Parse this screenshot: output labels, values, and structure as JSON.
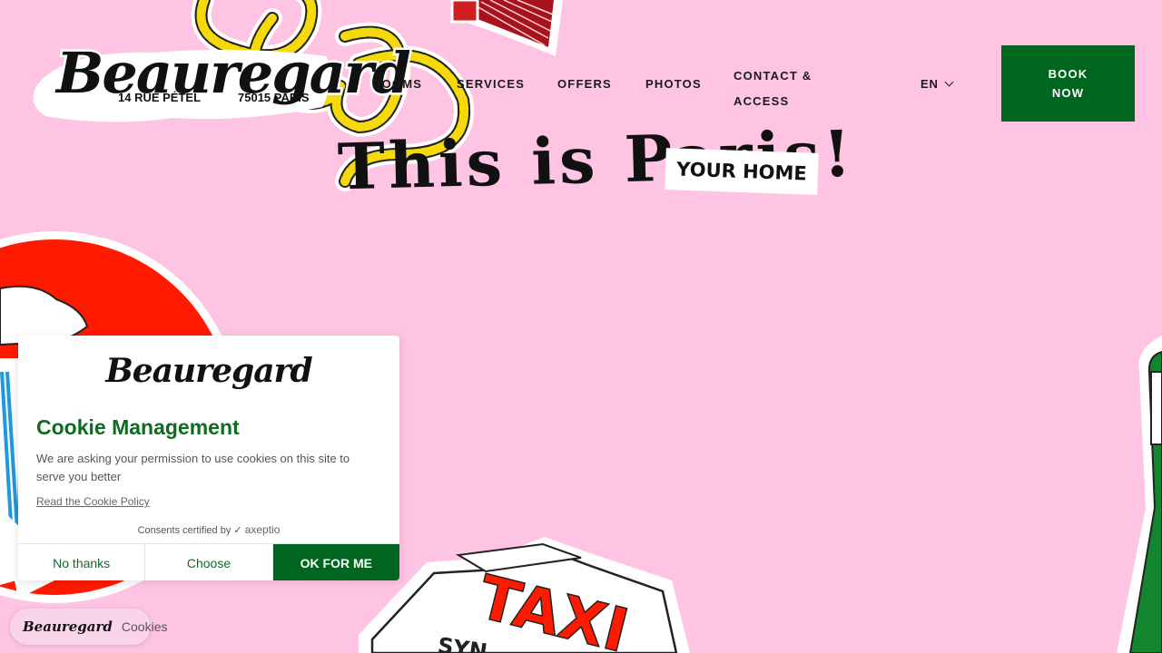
{
  "brand": {
    "logo": "Beauregard",
    "address_street": "14 RUE PÉTEL",
    "address_city": "75015 PARIS"
  },
  "nav": {
    "items": [
      "ROOMS",
      "SERVICES",
      "OFFERS",
      "PHOTOS",
      "CONTACT & ACCESS"
    ],
    "lang": "EN",
    "book_label": "BOOK NOW"
  },
  "hero": {
    "title": "This is Paris!",
    "sticker": "YOUR HOME"
  },
  "decor": {
    "taxi_sign": "TAXI",
    "taxi_sub": "SYN"
  },
  "cookie": {
    "logo": "Beauregard",
    "title": "Cookie Management",
    "text": "We are asking your permission to use cookies on this site to serve you better",
    "policy_link": "Read the Cookie Policy",
    "certified": "Consents certified by",
    "certifier": "axeptio",
    "btn_no": "No thanks",
    "btn_choose": "Choose",
    "btn_ok": "OK FOR ME"
  },
  "cookie_pill": {
    "logo": "Beauregard",
    "label": "Cookies"
  },
  "colors": {
    "background": "#ffc4e3",
    "brand_green": "#00661f",
    "rope_yellow": "#f5d90a",
    "red": "#ff1a00"
  }
}
